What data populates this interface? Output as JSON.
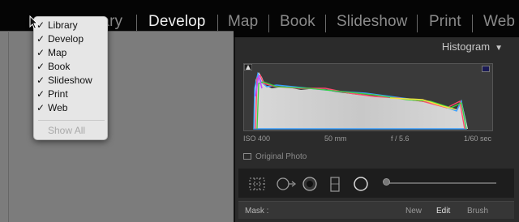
{
  "module_bar": {
    "modules": [
      {
        "label": "Library",
        "visible_label": "rary"
      },
      {
        "label": "Develop",
        "active": true
      },
      {
        "label": "Map"
      },
      {
        "label": "Book"
      },
      {
        "label": "Slideshow"
      },
      {
        "label": "Print"
      },
      {
        "label": "Web"
      }
    ]
  },
  "module_menu": {
    "items": [
      {
        "label": "Library",
        "checked": true
      },
      {
        "label": "Develop",
        "checked": true
      },
      {
        "label": "Map",
        "checked": true
      },
      {
        "label": "Book",
        "checked": true
      },
      {
        "label": "Slideshow",
        "checked": true
      },
      {
        "label": "Print",
        "checked": true
      },
      {
        "label": "Web",
        "checked": true
      }
    ],
    "check_glyph": "✓",
    "show_all": "Show All"
  },
  "histogram_panel": {
    "title": "Histogram",
    "collapse_glyph": "▼",
    "exif": {
      "iso": "ISO 400",
      "focal_length": "50 mm",
      "aperture": "f / 5.6",
      "shutter": "1/60 sec"
    },
    "original_photo_label": "Original Photo"
  },
  "mask_row": {
    "label": "Mask :",
    "options": [
      "New",
      "Edit",
      "Brush"
    ],
    "selected": "Edit"
  },
  "colors": {
    "module_active": "#efefef",
    "module_inactive": "#8a8a8a",
    "panel_bg": "#2b2b2b",
    "left_area_bg": "#7c7c7c",
    "menu_bg": "#e6e6e6"
  }
}
